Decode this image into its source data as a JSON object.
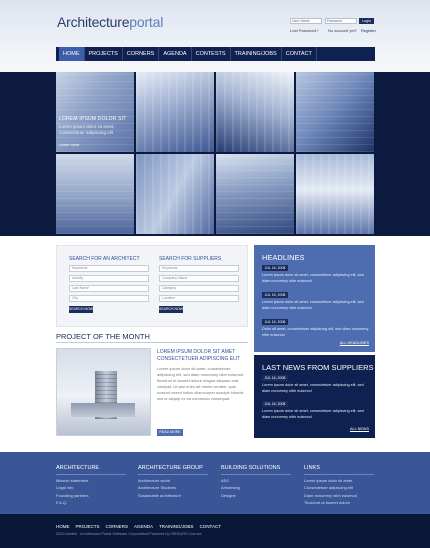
{
  "header": {
    "logo_part1": "Architecture",
    "logo_part2": "portal",
    "login": {
      "username_placeholder": "User Name",
      "password_placeholder": "Password",
      "login_button": "Login",
      "lost_password": "Lost Password?",
      "no_account": "No account yet?",
      "register": "Register"
    }
  },
  "nav": {
    "items": [
      "HOME",
      "PROJECTS",
      "CORNERS",
      "AGENDA",
      "CONTESTS",
      "TRAINING/JOBS",
      "CONTACT"
    ]
  },
  "hero": {
    "caption_title": "LOREM IPSUM DOLOR SIT",
    "caption_sub": "Lorem ipsum dolor sit amet, consectetuer adipiscing elit",
    "caption_more": "Learn more"
  },
  "search": {
    "architect": {
      "title": "SEARCH FOR AN ARCHITECT",
      "fields": [
        "Keywords",
        "Activity",
        "Last Name",
        "City"
      ],
      "button": "SEARCH NOW"
    },
    "suppliers": {
      "title": "SEARCH FOR SUPPLIERS",
      "fields": [
        "Keywords",
        "Company Name",
        "Category",
        "Location"
      ],
      "button": "SEARCH NOW"
    }
  },
  "project_of_month": {
    "title": "PROJECT OF THE MONTH",
    "headline": "LOREM IPSUM DOLOR SIT AMET CONSECTETUER ADIPISCING ELIT",
    "text": "Lorem ipsum dolor sit amet, consectetuer adipiscing elit, sed diam nonummy nibh euismod tincidunt ut laoreet dolore magna aliquam erat volutpat. Ut wisi enim ad minim veniam, quis nostrud exerci tation ullamcorper suscipit lobortis nisl ut aliquip ex ea commodo consequat.",
    "read_more": "READ MORE"
  },
  "headlines": {
    "title": "HEADLINES",
    "items": [
      {
        "date": "JUL 16, 2008",
        "text": "Lorem ipsum dolor sit amet, consectetuer adipiscing elit, sed diam nonummy nibh euismod"
      },
      {
        "date": "JUL 16, 2008",
        "text": "Lorem ipsum dolor sit amet, consectetuer adipiscing elit, sed diam nonummy nibh euismod"
      },
      {
        "date": "JUL 16, 2008",
        "text": "Dolor sit amet, consectetuer adipiscing elit, sed diam nonummy nibh euismod"
      }
    ],
    "all_link": "ALL HEADLINES"
  },
  "suppliers_news": {
    "title": "LAST NEWS FROM SUPPLIERS",
    "items": [
      {
        "date": "JUL 16, 2008",
        "text": "Lorem ipsum dolor sit amet, consectetuer adipiscing elit, sed diam nonummy nibh euismod"
      },
      {
        "date": "JUL 16, 2008",
        "text": "Lorem ipsum dolor sit amet, consectetuer adipiscing elit, sed diam nonummy nibh euismod"
      }
    ],
    "all_link": "ALL NEWS"
  },
  "footer": {
    "columns": [
      {
        "title": "ARCHITECTURE",
        "links": [
          "Mission statement",
          "Legal info",
          "Founding partners",
          "F.A.Q."
        ]
      },
      {
        "title": "ARCHITECTURE GROUP",
        "links": [
          "Architecture world",
          "Architecture Students",
          "Sustainable architecture"
        ]
      },
      {
        "title": "BUILDING SOLUTIONS",
        "links": [
          "ADC",
          "Arhidesing",
          "Designe"
        ]
      },
      {
        "title": "LINKS",
        "links": [
          "Lorem ipsum dolor sit amet",
          "Consectetuer adipiscing elit",
          "Diam nonummy nibh euismod",
          "Tincidunt ut laoreet dolore"
        ]
      }
    ],
    "bottom_nav": [
      "HOME",
      "PROJECTS",
      "CORNERS",
      "AGENDA",
      "TRAINING/JOBS",
      "CONTACT"
    ],
    "copyright": "2010 Arkitek · Architecture Portal Software Corporation/Powered by ISEGURS Licence"
  }
}
